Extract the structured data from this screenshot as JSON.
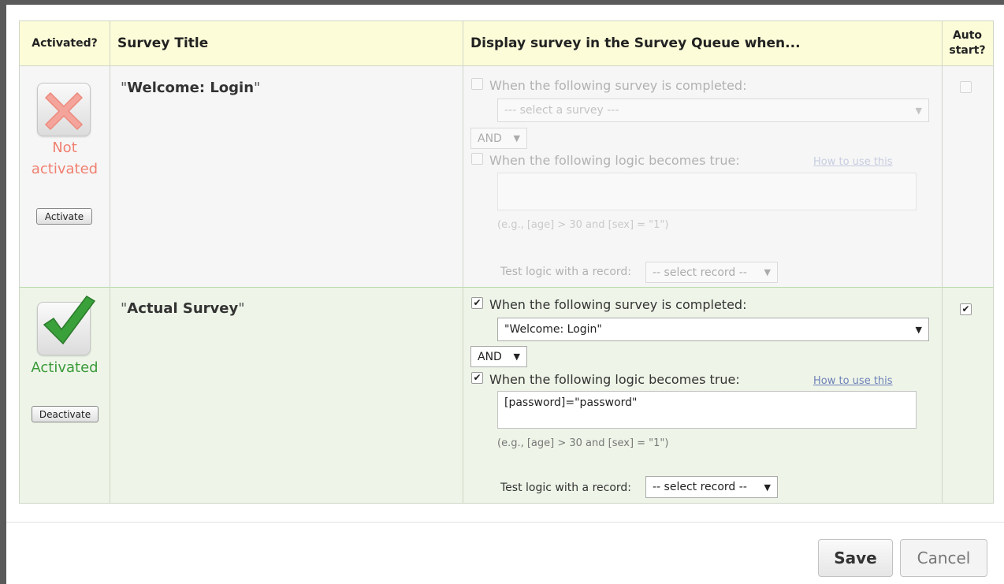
{
  "headers": {
    "activated": "Activated?",
    "title": "Survey Title",
    "display": "Display survey in the Survey Queue when...",
    "auto_line1": "Auto",
    "auto_line2": "start?"
  },
  "rows": [
    {
      "survey_title": "Welcome: Login",
      "quote_open": "\"",
      "quote_close": "\"",
      "status_line1": "Not",
      "status_line2": "activated",
      "toggle_label": "Activate",
      "survey_cond_label": "When the following survey is completed:",
      "survey_select": "--- select a survey ---",
      "and_select": "AND",
      "logic_cond_label": "When the following logic becomes true:",
      "how_to": "How to use this",
      "logic_value": "",
      "example": "(e.g., [age] > 30 and [sex] = \"1\")",
      "test_label": "Test logic with a record:",
      "record_select": "-- select record --",
      "survey_cond_checked": false,
      "logic_cond_checked": false,
      "auto_start": false
    },
    {
      "survey_title": "Actual Survey",
      "quote_open": "\"",
      "quote_close": "\"",
      "status_line1": "Activated",
      "toggle_label": "Deactivate",
      "survey_cond_label": "When the following survey is completed:",
      "survey_select": "\"Welcome: Login\"",
      "and_select": "AND",
      "logic_cond_label": "When the following logic becomes true:",
      "how_to": "How to use this",
      "logic_value": "[password]=\"password\"",
      "example": "(e.g., [age] > 30 and [sex] = \"1\")",
      "test_label": "Test logic with a record:",
      "record_select": "-- select record --",
      "survey_cond_checked": true,
      "logic_cond_checked": true,
      "auto_start": true
    }
  ],
  "footer": {
    "save": "Save",
    "cancel": "Cancel"
  },
  "colors": {
    "not_activated": "#f08070",
    "activated": "#3a9a3a",
    "header_bg": "#fcfcd8",
    "active_row_bg": "#eef5e8"
  },
  "icons": {
    "row1": "red-x-icon",
    "row2": "green-check-icon",
    "dropdown": "caret-down-icon"
  }
}
